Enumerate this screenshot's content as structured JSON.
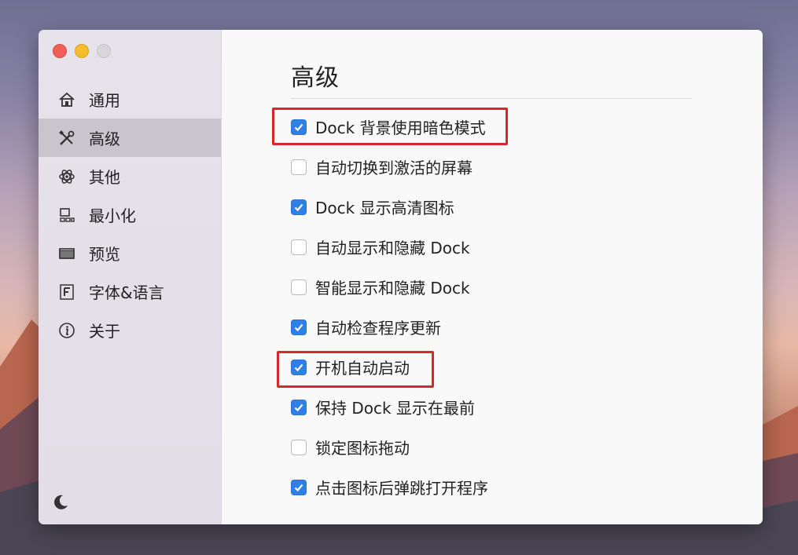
{
  "window": {
    "traffic_lights": [
      "close",
      "minimize",
      "zoom"
    ]
  },
  "sidebar": {
    "items": [
      {
        "label": "通用",
        "icon": "home-icon",
        "active": false
      },
      {
        "label": "高级",
        "icon": "tools-icon",
        "active": true
      },
      {
        "label": "其他",
        "icon": "atom-icon",
        "active": false
      },
      {
        "label": "最小化",
        "icon": "minimize-windows-icon",
        "active": false
      },
      {
        "label": "预览",
        "icon": "preview-window-icon",
        "active": false
      },
      {
        "label": "字体&语言",
        "icon": "font-icon",
        "active": false
      },
      {
        "label": "关于",
        "icon": "info-icon",
        "active": false
      }
    ],
    "footer_icon": "moon-icon"
  },
  "main": {
    "title": "高级",
    "options": [
      {
        "label": "Dock 背景使用暗色模式",
        "checked": true,
        "highlighted": true
      },
      {
        "label": "自动切换到激活的屏幕",
        "checked": false,
        "highlighted": false
      },
      {
        "label": "Dock 显示高清图标",
        "checked": true,
        "highlighted": false
      },
      {
        "label": "自动显示和隐藏 Dock",
        "checked": false,
        "highlighted": false
      },
      {
        "label": "智能显示和隐藏 Dock",
        "checked": false,
        "highlighted": false
      },
      {
        "label": "自动检查程序更新",
        "checked": true,
        "highlighted": false
      },
      {
        "label": "开机自动启动",
        "checked": true,
        "highlighted": true
      },
      {
        "label": "保持 Dock 显示在最前",
        "checked": true,
        "highlighted": false
      },
      {
        "label": "锁定图标拖动",
        "checked": false,
        "highlighted": false
      },
      {
        "label": "点击图标后弹跳打开程序",
        "checked": true,
        "highlighted": false
      }
    ]
  },
  "colors": {
    "checkbox_on": "#2f80e6",
    "highlight_box": "#d9262a",
    "sidebar_active": "#c9c5cc"
  }
}
